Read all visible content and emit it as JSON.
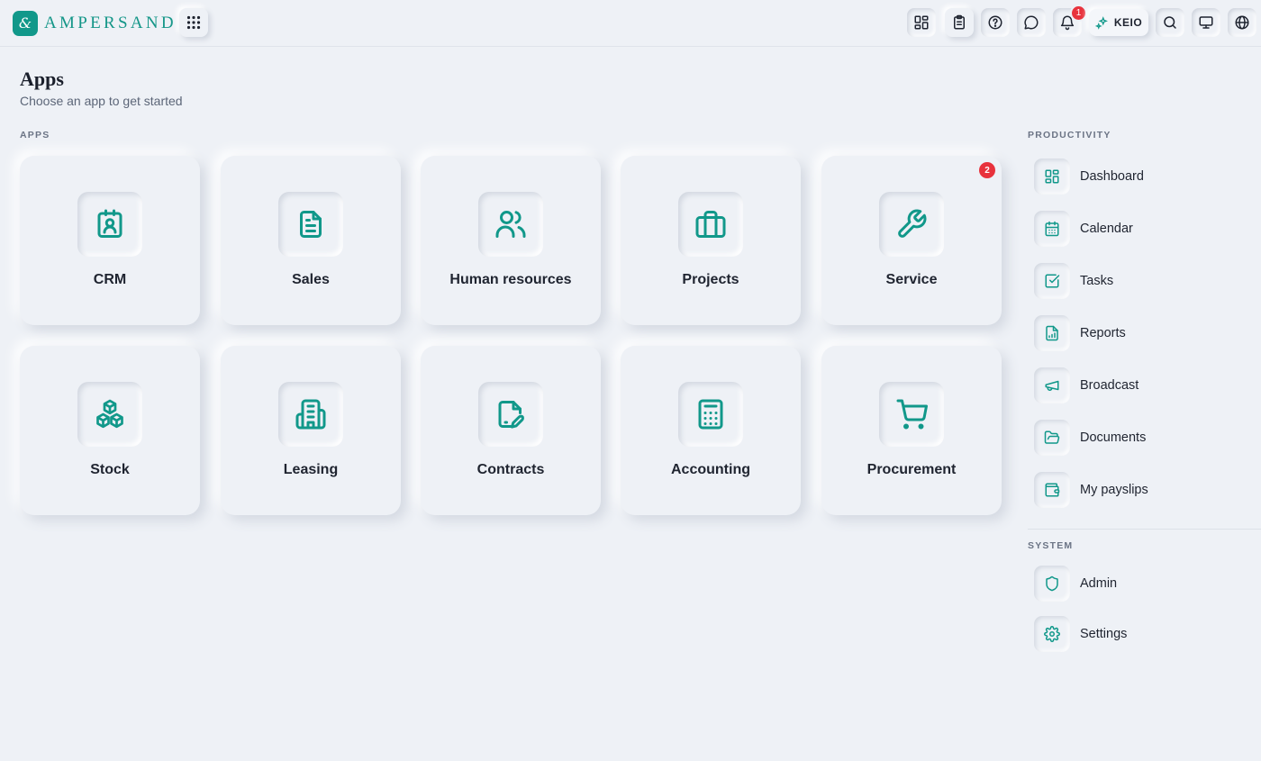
{
  "brand": {
    "name": "AMPERSAND",
    "mark": "&",
    "accent_color": "#11988a"
  },
  "topbar": {
    "buttons": [
      {
        "icon": "apps-grid-icon"
      },
      {
        "icon": "dashboard-icon"
      },
      {
        "icon": "clipboard-icon"
      },
      {
        "icon": "help-circle-icon"
      },
      {
        "icon": "chat-icon"
      },
      {
        "icon": "bell-icon",
        "badge": "1"
      },
      {
        "icon": "search-icon"
      },
      {
        "icon": "monitor-icon"
      },
      {
        "icon": "globe-icon"
      }
    ],
    "user_chip": {
      "label": "KEIO",
      "icon": "sparkle-icon"
    }
  },
  "page": {
    "title": "Apps",
    "subtitle": "Choose an app to get started"
  },
  "apps_section": {
    "label": "APPS",
    "apps": [
      {
        "label": "CRM",
        "icon": "contact-card-icon"
      },
      {
        "label": "Sales",
        "icon": "document-icon"
      },
      {
        "label": "Human resources",
        "icon": "users-icon"
      },
      {
        "label": "Projects",
        "icon": "briefcase-icon"
      },
      {
        "label": "Service",
        "icon": "wrench-icon",
        "badge": "2"
      },
      {
        "label": "Stock",
        "icon": "boxes-icon"
      },
      {
        "label": "Leasing",
        "icon": "building-icon"
      },
      {
        "label": "Contracts",
        "icon": "file-signature-icon"
      },
      {
        "label": "Accounting",
        "icon": "calculator-icon"
      },
      {
        "label": "Procurement",
        "icon": "cart-icon"
      }
    ]
  },
  "productivity": {
    "label": "PRODUCTIVITY",
    "items": [
      {
        "label": "Dashboard",
        "icon": "dashboard-icon"
      },
      {
        "label": "Calendar",
        "icon": "calendar-icon"
      },
      {
        "label": "Tasks",
        "icon": "check-square-icon"
      },
      {
        "label": "Reports",
        "icon": "report-icon"
      },
      {
        "label": "Broadcast",
        "icon": "megaphone-icon"
      },
      {
        "label": "Documents",
        "icon": "folder-open-icon"
      },
      {
        "label": "My payslips",
        "icon": "wallet-icon"
      }
    ]
  },
  "system": {
    "label": "SYSTEM",
    "items": [
      {
        "label": "Admin",
        "icon": "shield-icon"
      },
      {
        "label": "Settings",
        "icon": "gear-icon"
      }
    ]
  },
  "colors": {
    "background": "#eef1f6",
    "accent": "#11988a",
    "badge": "#e8323c"
  }
}
